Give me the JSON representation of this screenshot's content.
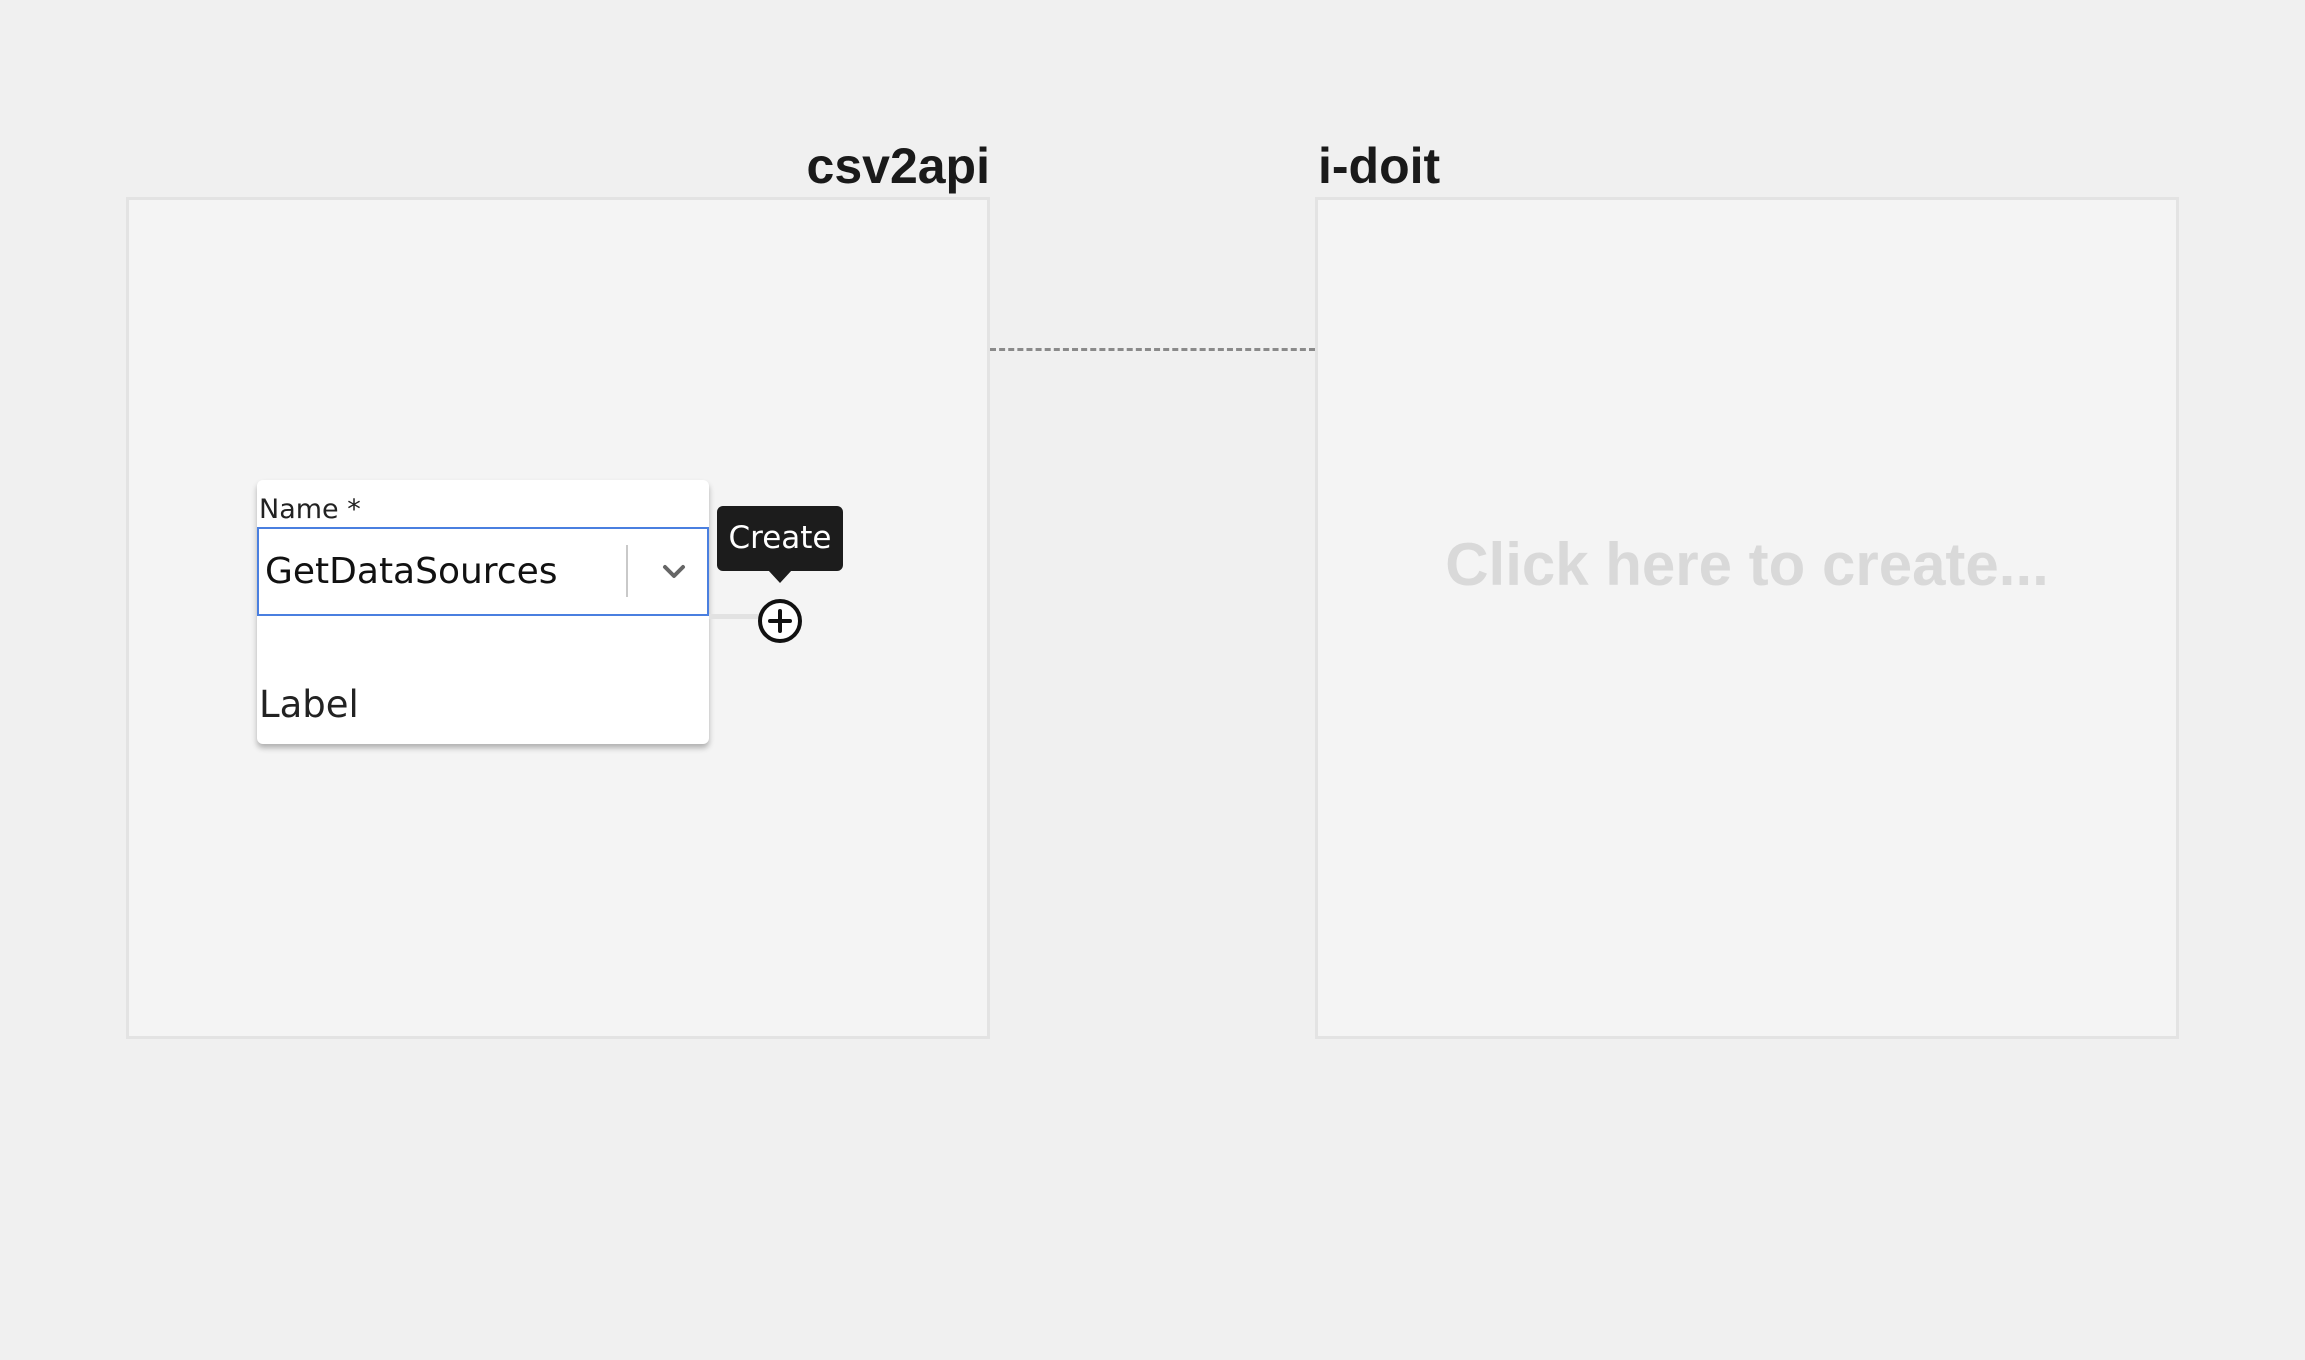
{
  "canvas": {
    "left_panel": {
      "title": "csv2api"
    },
    "right_panel": {
      "title": "i-doit",
      "placeholder": "Click here to create..."
    },
    "node": {
      "field_label": "Name *",
      "selected_value": "GetDataSources",
      "label": "Label"
    },
    "tooltip": {
      "text": "Create"
    }
  },
  "icons": {
    "dropdown": "chevron-down-icon",
    "create": "plus-circle-icon"
  },
  "colors": {
    "focus_border": "#4a7fe0",
    "tooltip_bg": "#1c1c1c",
    "placeholder_text": "#d9d9d9"
  }
}
